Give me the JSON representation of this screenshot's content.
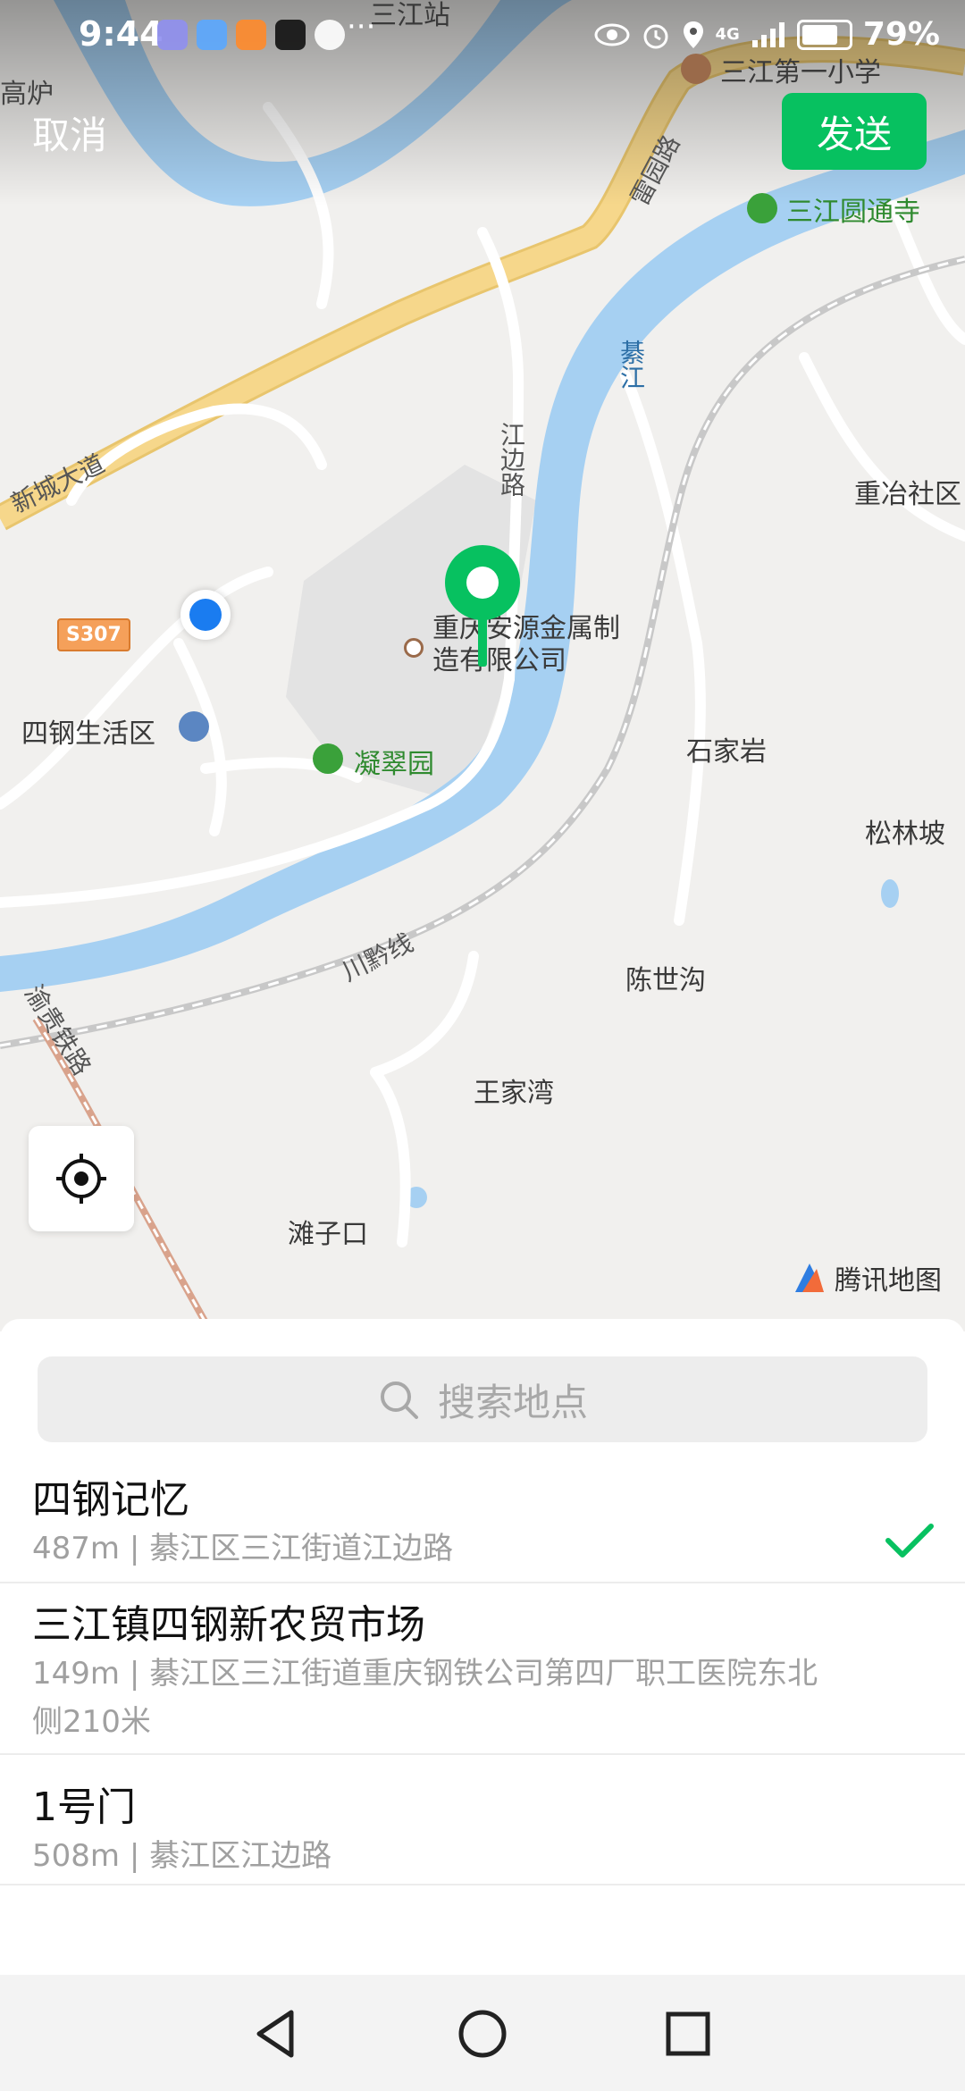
{
  "status_bar": {
    "time": "9:44",
    "more": "···",
    "network": "4G",
    "battery": "79%"
  },
  "header": {
    "cancel_label": "取消",
    "send_label": "发送"
  },
  "map": {
    "labels": {
      "sanjiang_station": "三江站",
      "gaolu": "高炉",
      "sanjiang_primary": "三江第一小学",
      "sanjiang_temple": "三江圆通寺",
      "road_lei": "雷园路",
      "xincheng": "新城大道",
      "jiangbian": "江边路",
      "qijiang": "綦江",
      "chongye": "重冶社区",
      "highway": "S307",
      "company": "重庆安源金属制造有限公司",
      "sigang_living": "四钢生活区",
      "ningcui": "凝翠园",
      "shijiayan": "石家岩",
      "songlinpo": "松林坡",
      "chuanqian": "川黔线",
      "chenshigou": "陈世沟",
      "yugui": "渝贵铁路",
      "wangjiawan": "王家湾",
      "tanzikou": "滩子口"
    },
    "brand": "腾讯地图"
  },
  "search": {
    "placeholder": "搜索地点"
  },
  "results": [
    {
      "title": "四钢记忆",
      "distance": "487m | 綦江区三江街道江边路",
      "selected": true
    },
    {
      "title": "三江镇四钢新农贸市场",
      "distance": "149m | 綦江区三江街道重庆钢铁公司第四厂职工医院东北侧210米",
      "selected": false
    },
    {
      "title": "1号门",
      "distance": "508m | 綦江区江边路",
      "selected": false
    }
  ],
  "colors": {
    "accent": "#07c160",
    "river": "#a6d0f2",
    "main_road": "#f6d78b",
    "user_location": "#1a7cf0"
  }
}
